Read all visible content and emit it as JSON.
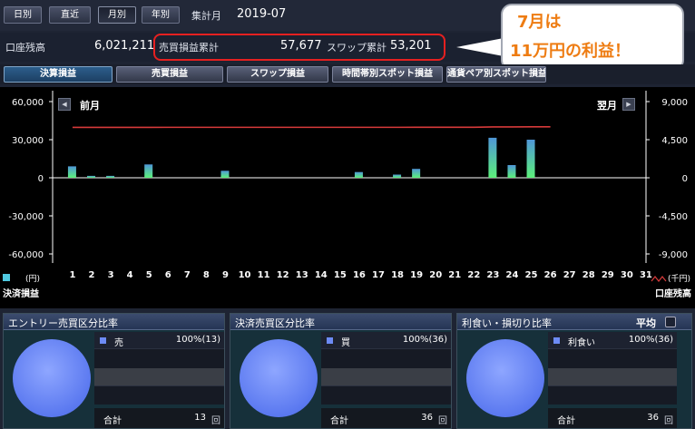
{
  "period_buttons": [
    "日別",
    "直近",
    "月別",
    "年別"
  ],
  "active_period": "月別",
  "aggregation": {
    "label": "集計月",
    "value": "2019-07"
  },
  "balance": {
    "label": "口座残高",
    "value": "6,021,211"
  },
  "trade_pl": {
    "label": "売買損益累計",
    "value": "57,677"
  },
  "swap_pl": {
    "label": "スワップ累計",
    "value": "53,201"
  },
  "bubble": {
    "line1": "7月は",
    "line2": "11万円の利益！"
  },
  "tabs": [
    "決算損益",
    "売買損益",
    "スワップ損益",
    "時間帯別スポット損益",
    "通貨ペア別スポット損益"
  ],
  "active_tab": "決算損益",
  "nav": {
    "prev": "前月",
    "next": "翌月"
  },
  "legend": {
    "left_unit": "(円)",
    "left_name": "決済損益",
    "right_unit": "(千円)",
    "right_name": "口座残高"
  },
  "colors": {
    "bar_top": "#4f97d8",
    "bar_bottom": "#5cf07a",
    "balance_line": "#d63a3a",
    "accent": "#ee7c12"
  },
  "chart_data": {
    "type": "bar",
    "categories": [
      "1",
      "2",
      "3",
      "4",
      "5",
      "6",
      "7",
      "8",
      "9",
      "10",
      "11",
      "12",
      "13",
      "14",
      "15",
      "16",
      "17",
      "18",
      "19",
      "20",
      "21",
      "22",
      "23",
      "24",
      "25",
      "26",
      "27",
      "28",
      "29",
      "30",
      "31"
    ],
    "series": [
      {
        "name": "決済損益",
        "values": [
          9000,
          1500,
          1500,
          0,
          10500,
          0,
          0,
          0,
          5500,
          0,
          0,
          0,
          0,
          0,
          0,
          4500,
          0,
          2500,
          7000,
          0,
          0,
          0,
          31500,
          10000,
          30000,
          0,
          0,
          0,
          0,
          0,
          0
        ]
      },
      {
        "name": "口座残高",
        "type": "line",
        "values": [
          5950,
          5950,
          5950,
          5950,
          5950,
          5960,
          5960,
          5960,
          5960,
          5960,
          5960,
          5960,
          5960,
          5960,
          5960,
          5960,
          5960,
          5960,
          5965,
          5965,
          5965,
          5965,
          6010,
          6010,
          6021,
          6021
        ]
      }
    ],
    "left_ticks": [
      "60,000",
      "30,000",
      "0",
      "-30,000",
      "-60,000"
    ],
    "right_ticks": [
      "9,000",
      "4,500",
      "0",
      "-4,500",
      "-9,000"
    ],
    "ylim_left": [
      -60000,
      60000
    ],
    "ylim_right": [
      -9000,
      9000
    ]
  },
  "panels": [
    {
      "title": "エントリー売買区分比率",
      "item": "売",
      "value": "100%(13)",
      "total_label": "合計",
      "total": "13",
      "unit": "回"
    },
    {
      "title": "決済売買区分比率",
      "item": "買",
      "value": "100%(36)",
      "total_label": "合計",
      "total": "36",
      "unit": "回"
    },
    {
      "title": "利食い・損切り比率",
      "item": "利食い",
      "value": "100%(36)",
      "total_label": "合計",
      "total": "36",
      "unit": "回",
      "avg_label": "平均"
    }
  ]
}
